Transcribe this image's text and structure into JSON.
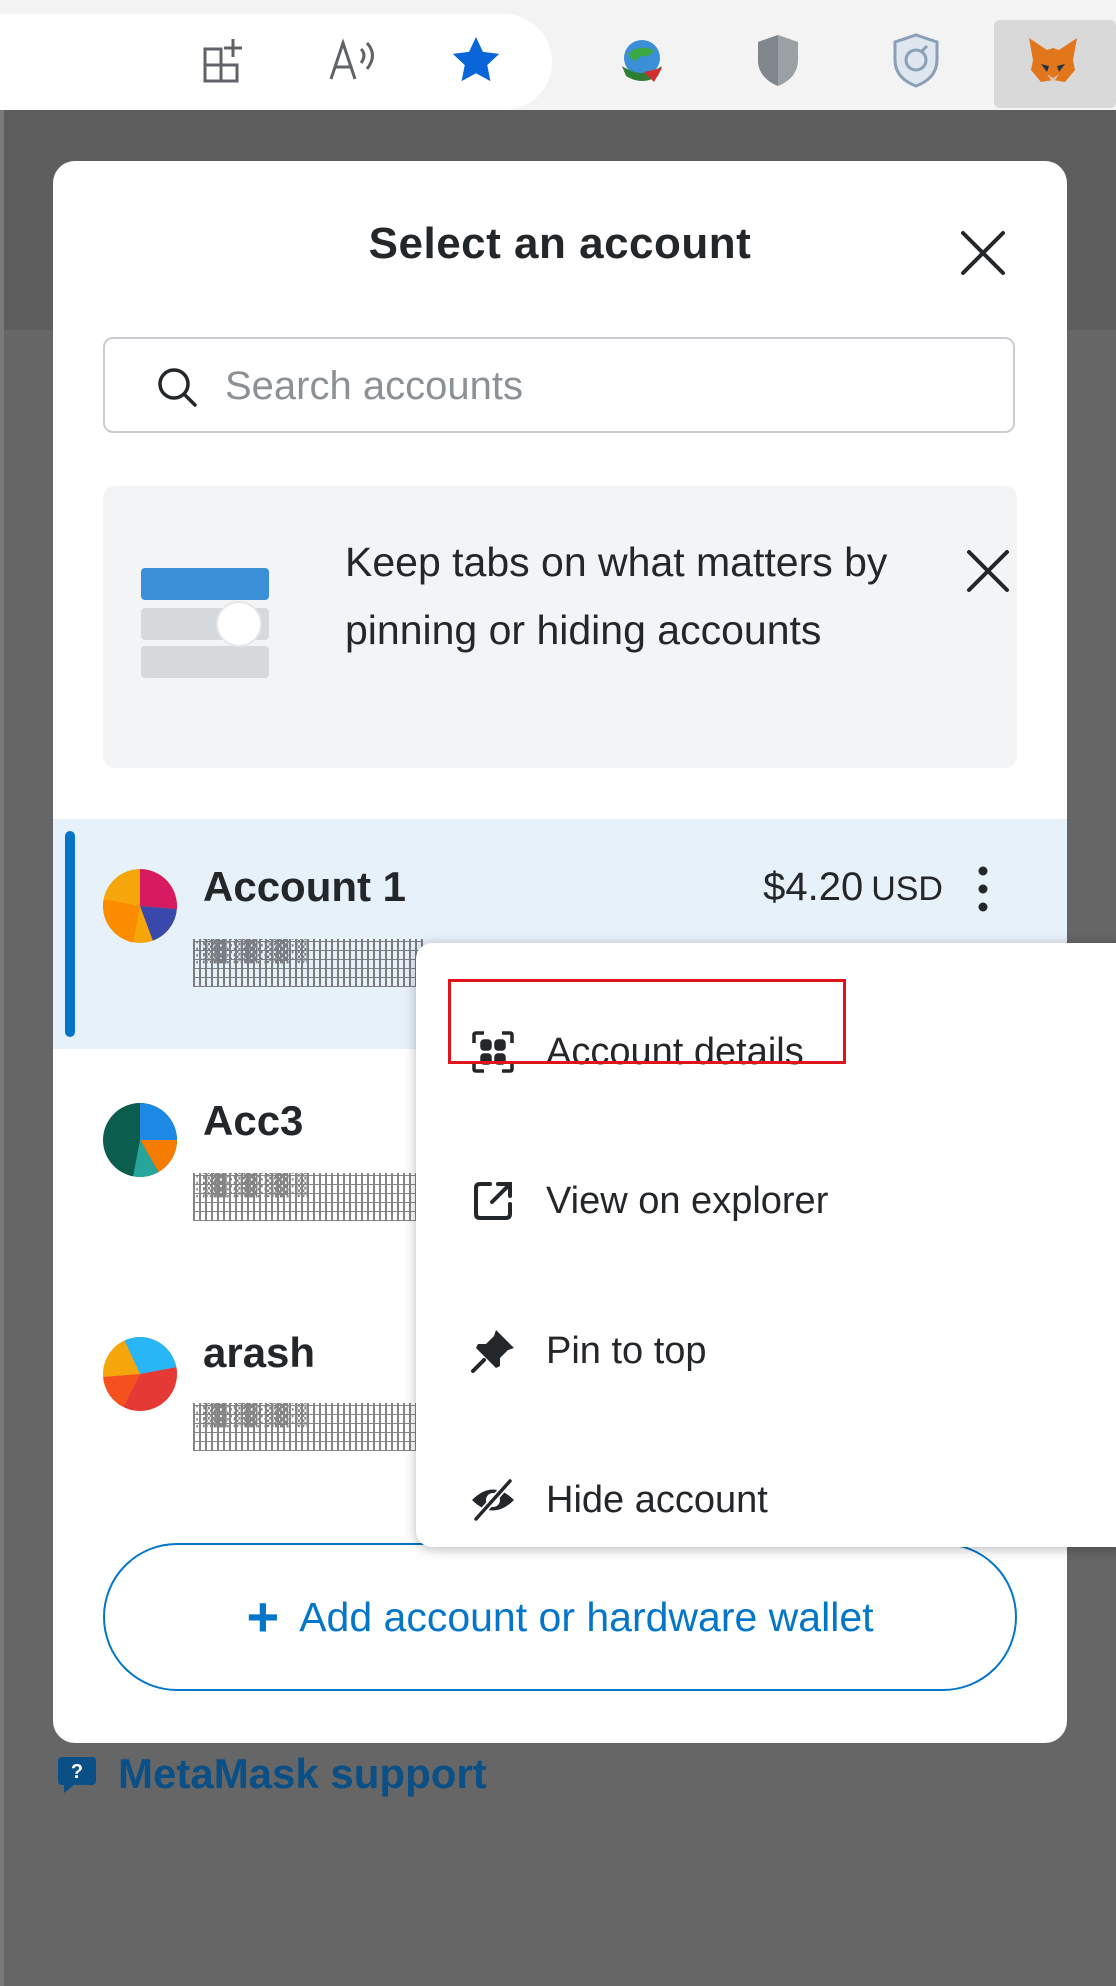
{
  "toolbar": {
    "icons": [
      "add-to-collections-icon",
      "read-aloud-icon",
      "favorite-star-icon",
      "globe-extension-icon",
      "shield-extension-icon",
      "privacy-extension-icon",
      "metamask-fox-icon"
    ]
  },
  "modal": {
    "title": "Select an account",
    "search": {
      "placeholder": "Search accounts",
      "value": ""
    },
    "banner": {
      "text": "Keep tabs on what matters by pinning or hiding accounts"
    },
    "accounts": [
      {
        "name": "Account 1",
        "address": "░▒▓░▒▓░▒▓░▒",
        "balance": "$4.20",
        "currency": "USD",
        "selected": true
      },
      {
        "name": "Acc3",
        "address": "░▒▓░▒▓░▒▓░▒",
        "selected": false
      },
      {
        "name": "arash",
        "address": "░▒▓░▒▓░▒▓░▒",
        "selected": false
      }
    ],
    "add_button": "Add account or hardware wallet"
  },
  "menu": {
    "items": [
      {
        "label": "Account details",
        "icon": "scan-barcode-icon"
      },
      {
        "label": "View on explorer",
        "icon": "export-link-icon"
      },
      {
        "label": "Pin to top",
        "icon": "pin-icon"
      },
      {
        "label": "Hide account",
        "icon": "eye-slash-icon"
      }
    ]
  },
  "support": {
    "label": "MetaMask support"
  },
  "colors": {
    "primary": "#0376c9",
    "selected_bg": "#e7f1fa",
    "highlight": "#e1141c",
    "text": "#24272a"
  }
}
